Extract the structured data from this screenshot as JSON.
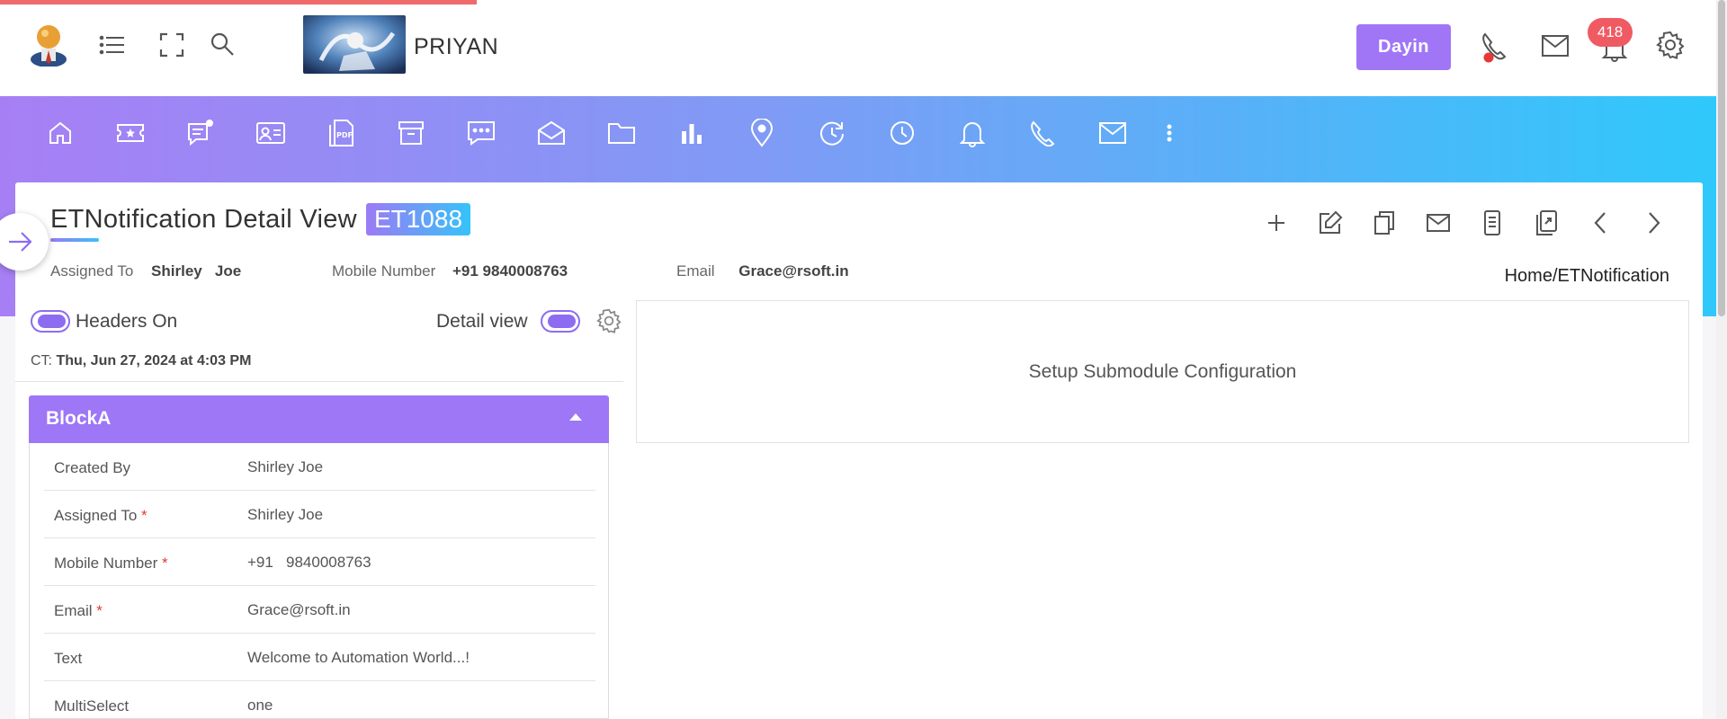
{
  "header": {
    "brand_name": "PRIYAN",
    "user_button": "Dayin",
    "notification_count": "418",
    "icons": [
      "avatar",
      "list-icon",
      "fullscreen-icon",
      "search-icon",
      "phone-call-icon",
      "mail-icon",
      "bell-icon",
      "gear-icon"
    ]
  },
  "nav": {
    "icons": [
      "home-icon",
      "ticket-icon",
      "chat-note-icon",
      "contact-card-icon",
      "pdf-icon",
      "archive-icon",
      "message-icon",
      "envelope-open-icon",
      "folder-icon",
      "bar-chart-icon",
      "location-pin-icon",
      "refresh-clock-icon",
      "clock-icon",
      "bell-icon",
      "phone-icon",
      "mail-icon",
      "more-vertical-icon"
    ]
  },
  "page": {
    "title": "ETNotification Detail View",
    "record_id": "ET1088",
    "assigned_to_label": "Assigned To",
    "assigned_to_value": "Shirley   Joe",
    "mobile_label": "Mobile Number",
    "mobile_value": "+91 9840008763",
    "email_label": "Email",
    "email_value": "Grace@rsoft.in",
    "breadcrumb": "Home/ETNotification"
  },
  "panel": {
    "headers_toggle_label": "Headers On",
    "detail_toggle_label": "Detail view",
    "ct_prefix": "CT:",
    "ct_value": "Thu, Jun 27, 2024 at 4:03 PM"
  },
  "block": {
    "title": "BlockA",
    "fields": [
      {
        "label": "Created By",
        "required": "",
        "value": "Shirley Joe"
      },
      {
        "label": "Assigned To",
        "required": "*",
        "value": "Shirley Joe"
      },
      {
        "label": "Mobile Number",
        "required": "*",
        "value": "+91   9840008763"
      },
      {
        "label": "Email",
        "required": "*",
        "value": "Grace@rsoft.in"
      },
      {
        "label": "Text",
        "required": "",
        "value": "Welcome to Automation World...!"
      },
      {
        "label": "MultiSelect",
        "required": "",
        "value": "one"
      }
    ]
  },
  "submodule": {
    "message": "Setup Submodule Configuration"
  },
  "colors": {
    "accent": "#9d77f6",
    "gradient_start": "#a77ff5",
    "gradient_end": "#2fc8fb",
    "badge_red": "#f05a63"
  }
}
